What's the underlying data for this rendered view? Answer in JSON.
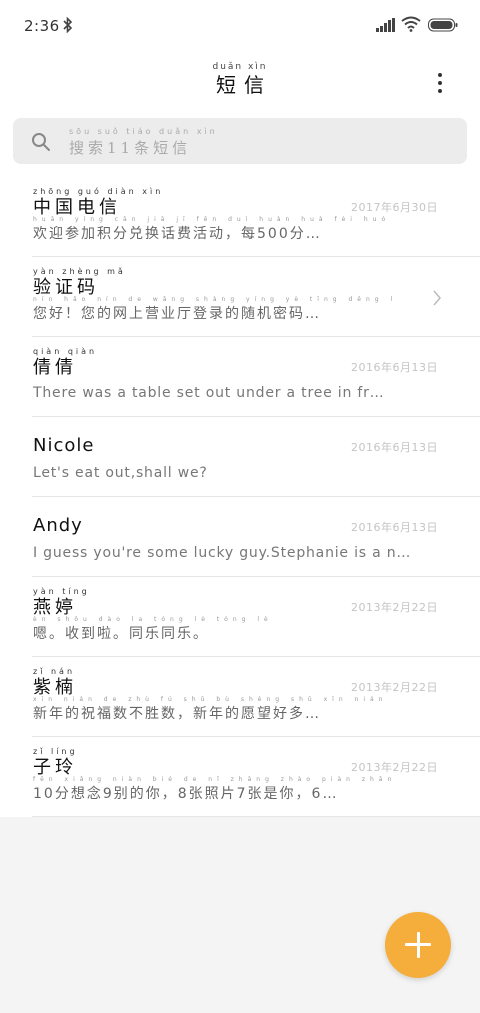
{
  "status_bar": {
    "time": "2:36",
    "icons": [
      "bluetooth-icon",
      "signal-icon",
      "wifi-icon",
      "battery-icon"
    ]
  },
  "header": {
    "title_pinyin": "duǎn xìn",
    "title": "短信",
    "more_icon": "more-vertical-icon"
  },
  "search": {
    "icon": "search-icon",
    "placeholder_pinyin": "sōu suǒ tiáo duǎn xìn",
    "placeholder": "搜索11条短信"
  },
  "conversations": [
    {
      "name_pinyin": "zhōng guó diàn xìn",
      "name": "中国电信",
      "date": "2017年6月30日",
      "message_pinyin": "huān yíng cān jiā jī fēn duì huàn huà fèi huó dòng měi",
      "message": "欢迎参加积分兑换话费活动，每500分…"
    },
    {
      "name_pinyin": "yàn zhèng mǎ",
      "name": "验证码",
      "date": "",
      "message_pinyin": "nín hǎo nín de wǎng shàng yíng yè tīng dēng lù de suí jī mì mǎ",
      "message": "您好！您的网上营业厅登录的随机密码…"
    },
    {
      "name_pinyin": "qiàn qiàn",
      "name": "倩倩",
      "date": "2016年6月13日",
      "message_pinyin": "",
      "message": "There was a table set out under a tree in fr…"
    },
    {
      "name_pinyin": "",
      "name": "Nicole",
      "date": "2016年6月13日",
      "message_pinyin": "",
      "message": "Let's eat out,shall we?"
    },
    {
      "name_pinyin": "",
      "name": "Andy",
      "date": "2016年6月13日",
      "message_pinyin": "",
      "message": "I guess you're some lucky guy.Stephanie is a n…"
    },
    {
      "name_pinyin": "yàn tíng",
      "name": "燕婷",
      "date": "2013年2月22日",
      "message_pinyin": "èn shōu dào la tóng lè tóng lè",
      "message": "嗯。收到啦。同乐同乐。"
    },
    {
      "name_pinyin": "zǐ nán",
      "name": "紫楠",
      "date": "2013年2月22日",
      "message_pinyin": "xīn nián de zhù fú shǔ bù shèng shǔ xīn nián de yuàn wàng hǎo duō",
      "message": "新年的祝福数不胜数，新年的愿望好多…"
    },
    {
      "name_pinyin": "zǐ líng",
      "name": "子玲",
      "date": "2013年2月22日",
      "message_pinyin": "fēn xiǎng niàn bié de nǐ zhāng zhào piàn zhāng shì nǐ",
      "message": "10分想念9别的你，8张照片7张是你，6…"
    }
  ],
  "fab": {
    "icon": "plus-icon",
    "color": "#f5ad3c"
  }
}
